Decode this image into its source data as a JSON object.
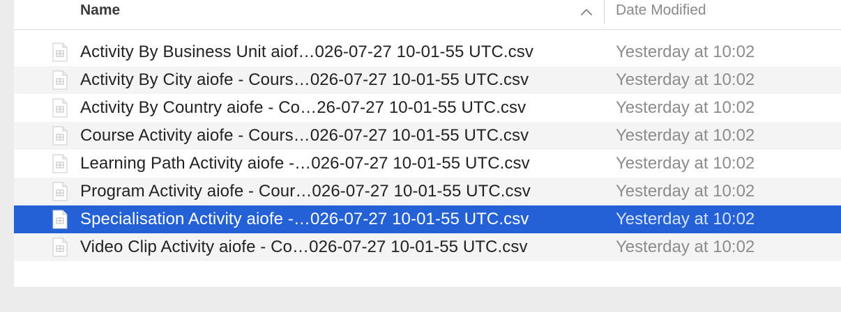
{
  "header": {
    "name_label": "Name",
    "date_label": "Date Modified",
    "sort_icon": "chevron-up-icon"
  },
  "files": [
    {
      "name": "Activity By Business Unit aiof…026-07-27 10-01-55 UTC.csv",
      "date": "Yesterday at 10:02",
      "selected": false
    },
    {
      "name": "Activity By City aiofe - Cours…026-07-27 10-01-55 UTC.csv",
      "date": "Yesterday at 10:02",
      "selected": false
    },
    {
      "name": "Activity By Country aiofe - Co…26-07-27 10-01-55 UTC.csv",
      "date": "Yesterday at 10:02",
      "selected": false
    },
    {
      "name": "Course Activity aiofe - Cours…026-07-27 10-01-55 UTC.csv",
      "date": "Yesterday at 10:02",
      "selected": false
    },
    {
      "name": "Learning Path Activity aiofe -…026-07-27 10-01-55 UTC.csv",
      "date": "Yesterday at 10:02",
      "selected": false
    },
    {
      "name": "Program Activity aiofe - Cour…026-07-27 10-01-55 UTC.csv",
      "date": "Yesterday at 10:02",
      "selected": false
    },
    {
      "name": "Specialisation Activity aiofe -…026-07-27 10-01-55 UTC.csv",
      "date": "Yesterday at 10:02",
      "selected": true
    },
    {
      "name": "Video Clip Activity aiofe - Co…026-07-27 10-01-55 UTC.csv",
      "date": "Yesterday at 10:02",
      "selected": false
    }
  ],
  "colors": {
    "selection": "#2460d6",
    "alt_row": "#f4f4f4"
  }
}
